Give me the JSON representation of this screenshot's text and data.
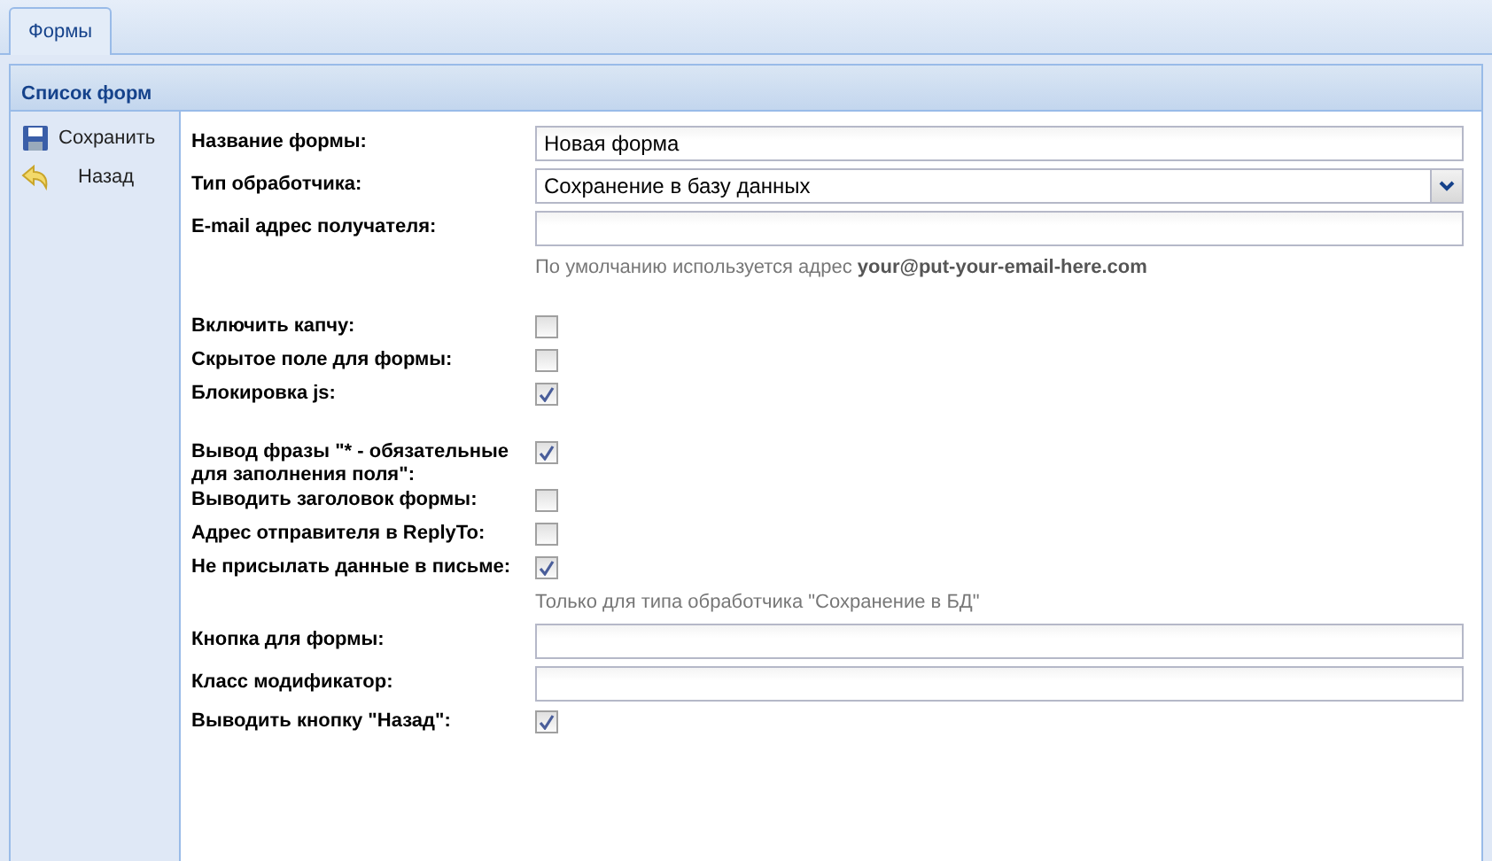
{
  "tabs": [
    {
      "label": "Формы",
      "selected": true
    }
  ],
  "panel": {
    "title": "Список форм"
  },
  "toolbar": [
    {
      "label": "Сохранить",
      "kind": "save"
    },
    {
      "label": "Назад",
      "kind": "back"
    }
  ],
  "groups": [
    [
      {
        "kind": "text",
        "label": "Название формы:",
        "value": "Новая форма"
      },
      {
        "kind": "select",
        "label": "Тип обработчика:",
        "value": "Сохранение в базу данных"
      },
      {
        "kind": "text",
        "label": "E-mail адрес получателя:"
      },
      {
        "kind": "hint",
        "text": "По умолчанию используется адрес **your@put-your-email-here.com**"
      }
    ],
    [
      {
        "kind": "checkbox",
        "label": "Включить капчу:",
        "checked": false
      },
      {
        "kind": "checkbox",
        "label": "Скрытое поле для формы:",
        "checked": false
      },
      {
        "kind": "checkbox",
        "label": "Блокировка js:",
        "checked": true
      }
    ],
    [
      {
        "kind": "checkbox",
        "label": "Вывод фразы \"* - обязательные для заполнения поля\":",
        "checked": true
      },
      {
        "kind": "checkbox",
        "label": "Выводить заголовок формы:",
        "checked": false
      },
      {
        "kind": "checkbox",
        "label": "Адрес отправителя в ReplyTo:",
        "checked": false
      },
      {
        "kind": "checkbox",
        "label": "Не присылать данные в письме:",
        "checked": true
      },
      {
        "kind": "hint",
        "text": "Только для типа обработчика \"Сохранение в БД\""
      },
      {
        "kind": "text",
        "label": "Кнопка для формы:"
      },
      {
        "kind": "text",
        "label": "Класс модификатор:"
      },
      {
        "kind": "checkbox",
        "label": "Выводить кнопку \"Назад\":",
        "checked": true
      }
    ]
  ]
}
